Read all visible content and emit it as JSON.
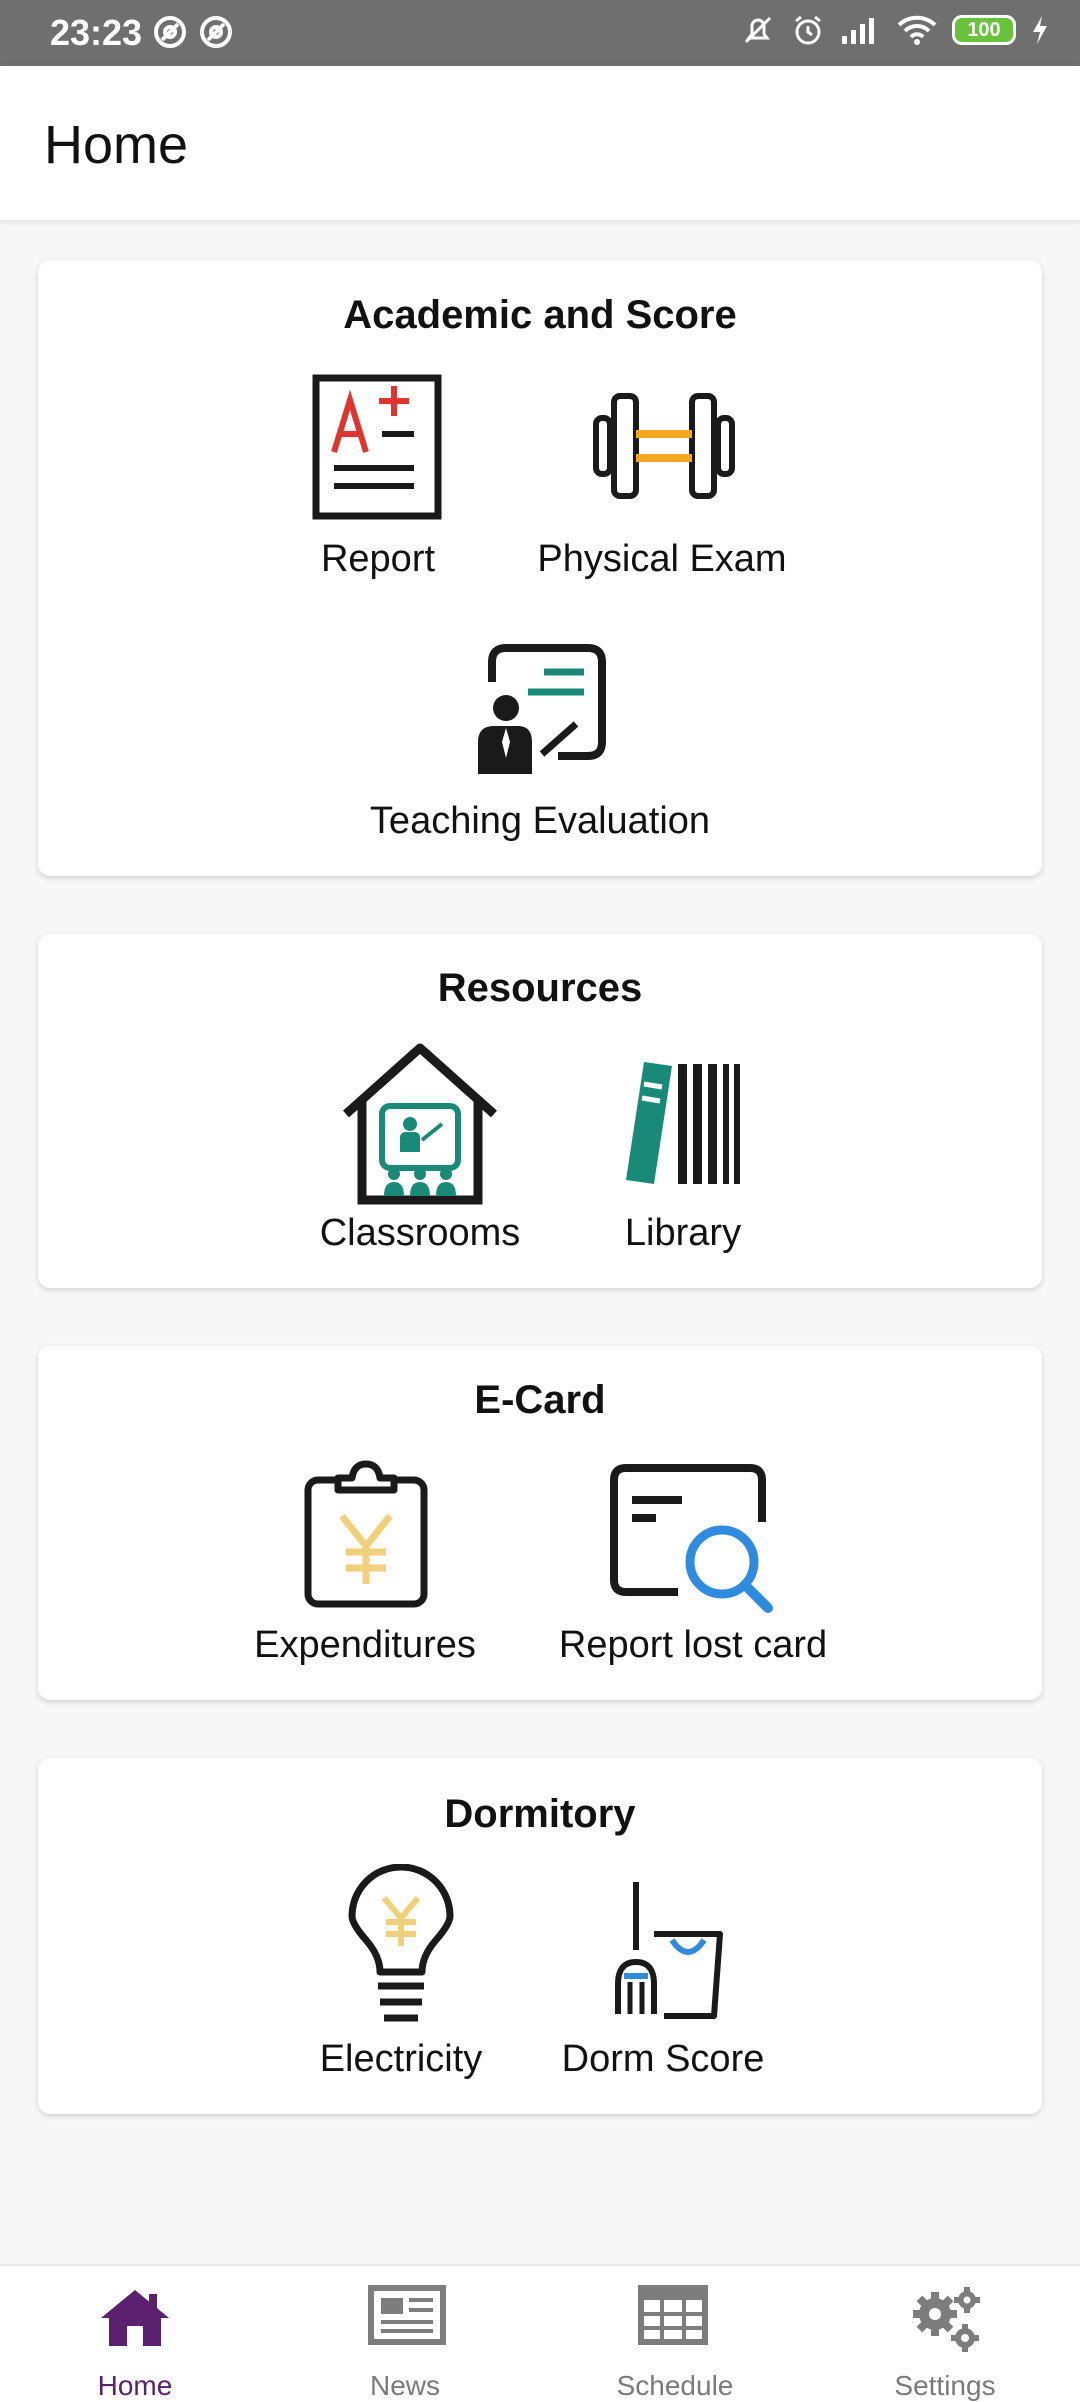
{
  "status_bar": {
    "time": "23:23",
    "battery": "100",
    "icons": [
      "at-sign-icon",
      "at-sign-icon",
      "mute-icon",
      "alarm-icon",
      "signal-icon",
      "wifi-icon",
      "battery-icon",
      "charging-icon"
    ]
  },
  "header": {
    "title": "Home"
  },
  "sections": [
    {
      "title": "Academic and Score",
      "items": [
        {
          "label": "Report",
          "icon": "report-card-icon"
        },
        {
          "label": "Physical Exam",
          "icon": "dumbbell-icon"
        },
        {
          "label": "Teaching Evaluation",
          "icon": "teacher-board-icon"
        }
      ]
    },
    {
      "title": "Resources",
      "items": [
        {
          "label": "Classrooms",
          "icon": "classroom-house-icon"
        },
        {
          "label": "Library",
          "icon": "books-icon"
        }
      ]
    },
    {
      "title": "E-Card",
      "items": [
        {
          "label": "Expenditures",
          "icon": "clipboard-yen-icon"
        },
        {
          "label": "Report lost card",
          "icon": "card-search-icon"
        }
      ]
    },
    {
      "title": "Dormitory",
      "items": [
        {
          "label": "Electricity",
          "icon": "lightbulb-yen-icon"
        },
        {
          "label": "Dorm Score",
          "icon": "broom-bucket-icon"
        }
      ]
    }
  ],
  "bottom_nav": [
    {
      "label": "Home",
      "icon": "home-icon",
      "active": true
    },
    {
      "label": "News",
      "icon": "newspaper-icon",
      "active": false
    },
    {
      "label": "Schedule",
      "icon": "grid-calendar-icon",
      "active": false
    },
    {
      "label": "Settings",
      "icon": "gears-icon",
      "active": false
    }
  ],
  "colors": {
    "accent": "#5b2170",
    "teal": "#1a8a78",
    "red": "#e0342e",
    "orange": "#f5a623",
    "yellow": "#f0d07a",
    "blue": "#2f8be0"
  }
}
